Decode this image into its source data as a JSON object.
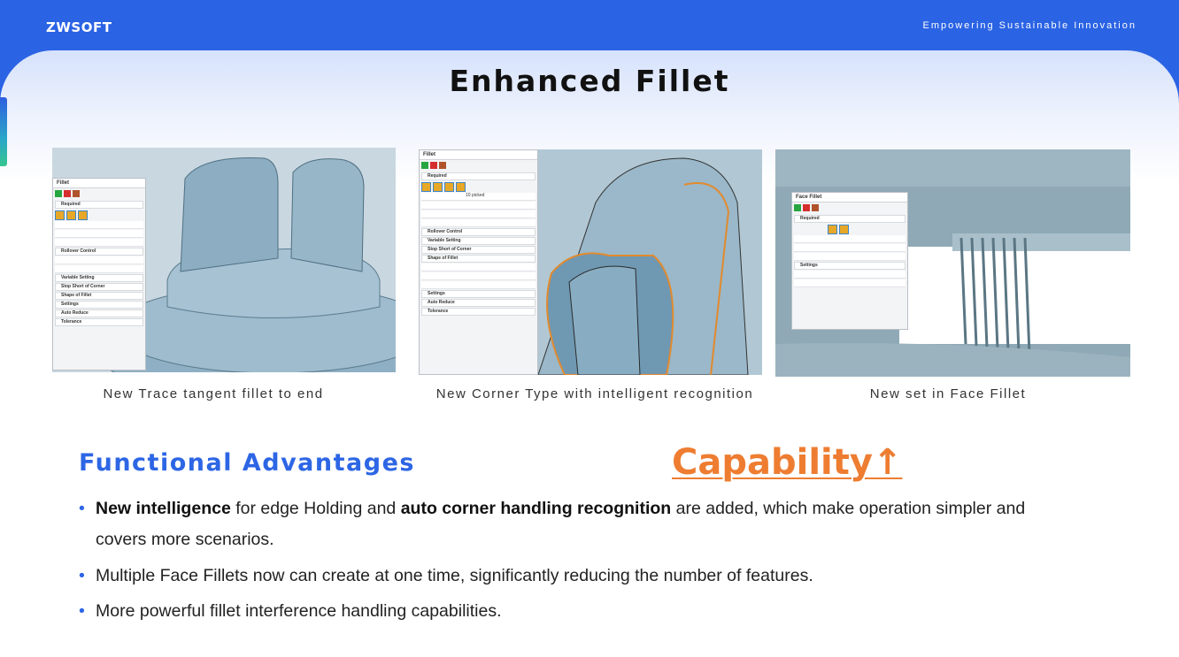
{
  "header": {
    "logo": "ZWSOFT",
    "tagline": "Empowering Sustainable Innovation"
  },
  "title": "Enhanced Fillet",
  "screenshots": [
    {
      "caption": "New Trace tangent fillet to end",
      "dialog_title": "Fillet",
      "sections": [
        "Required",
        "Rollover Control",
        "Variable Setting",
        "Stop Short of Corner",
        "Shape of Fillet",
        "Settings",
        "Auto Reduce",
        "Tolerance"
      ]
    },
    {
      "caption": "New Corner Type with intelligent recognition",
      "dialog_title": "Fillet",
      "edges_value": "10 picked",
      "sections": [
        "Required",
        "Rollover Control",
        "Variable Setting",
        "Stop Short of Corner",
        "Shape of Fillet",
        "Settings",
        "Auto Reduce",
        "Tolerance"
      ]
    },
    {
      "caption": "New set in Face Fillet",
      "dialog_title": "Face Fillet",
      "sections": [
        "Required",
        "Settings"
      ]
    }
  ],
  "advantages": {
    "heading": "Functional Advantages",
    "capability": "Capability↑",
    "bullets": [
      {
        "b1": "New intelligence",
        "t1": " for edge Holding and ",
        "b2": "auto corner handling recognition",
        "t2": " are added, which make operation simpler and covers more scenarios."
      },
      {
        "text": "Multiple Face Fillets now can create at one time, significantly reducing the number of features."
      },
      {
        "text": "More powerful fillet interference handling capabilities."
      }
    ]
  },
  "colors": {
    "brand_blue": "#2a63e4",
    "heading_blue": "#2d66e5",
    "accent_orange": "#ee7d31"
  }
}
